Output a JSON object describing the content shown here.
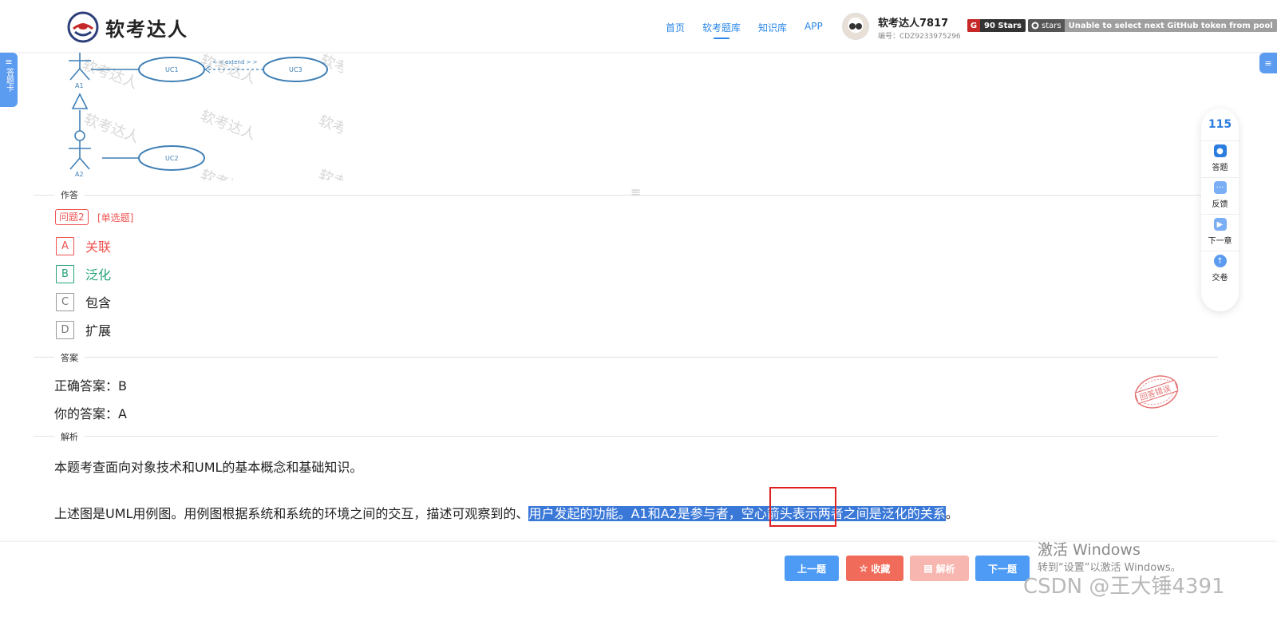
{
  "brand": {
    "name": "软考达人"
  },
  "nav": [
    {
      "label": "首页",
      "active": false
    },
    {
      "label": "软考题库",
      "active": true
    },
    {
      "label": "知识库",
      "active": false
    },
    {
      "label": "APP",
      "active": false
    }
  ],
  "user": {
    "name": "软考达人7817",
    "id": "编号：CDZ9233975296"
  },
  "badges": {
    "stars": "90 Stars",
    "gh_key": "stars",
    "gh_value": "Unable to select next GitHub token from pool"
  },
  "side": {
    "left_tab": "答题卡"
  },
  "diagram": {
    "actor1": "A1",
    "actor2": "A2",
    "uc1": "UC1",
    "uc2": "UC2",
    "uc3": "UC3",
    "extend": "< < extend > >",
    "watermark": "软考达人"
  },
  "sections": {
    "answer_area": "作答",
    "answer": "答案",
    "analysis": "解析"
  },
  "question": {
    "tag": "问题2",
    "type": "[单选题]",
    "options": [
      {
        "letter": "A",
        "label": "关联",
        "state": "wrong"
      },
      {
        "letter": "B",
        "label": "泛化",
        "state": "right"
      },
      {
        "letter": "C",
        "label": "包含",
        "state": "none"
      },
      {
        "letter": "D",
        "label": "扩展",
        "state": "none"
      }
    ]
  },
  "answer": {
    "correct": "正确答案：B",
    "yours": "你的答案：A",
    "stamp": "回答错误"
  },
  "analysis": {
    "p1": "本题考查面向对象技术和UML的基本概念和基础知识。",
    "p2_plain": "上述图是UML用例图。用例图根据系统和系统的环境之间的交互，描述可观察到的、",
    "p2_highlight": "用户发起的功能。A1和A2是参与者，空心箭头表示两者之间是泛化的关系",
    "p2_end": "。"
  },
  "float_panel": {
    "count": "115",
    "items": [
      {
        "label": "答题",
        "icon": "answer-icon"
      },
      {
        "label": "反馈",
        "icon": "feedback-icon"
      },
      {
        "label": "下一章",
        "icon": "next-chapter-icon"
      },
      {
        "label": "交卷",
        "icon": "submit-icon"
      }
    ]
  },
  "buttons": {
    "prev": "上一题",
    "fav": "收藏",
    "analysis": "解析",
    "next": "下一题"
  },
  "overlay": {
    "windows_line1": "激活 Windows",
    "windows_line2": "转到“设置”以激活 Windows。",
    "csdn": "CSDN @王大锤4391"
  },
  "colors": {
    "accent": "#2b87e8",
    "wrong": "#ef5350",
    "right": "#26a37a",
    "highlight": "#3a78d8"
  }
}
